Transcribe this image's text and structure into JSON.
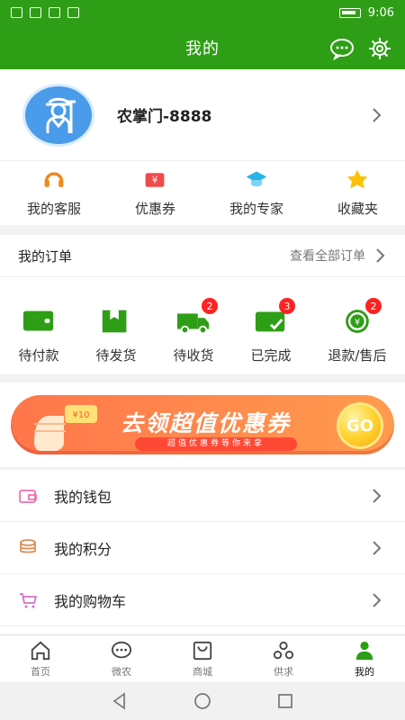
{
  "status": {
    "time": "9:06"
  },
  "header": {
    "title": "我的"
  },
  "profile": {
    "name": "农掌门-8888"
  },
  "quick_links": [
    {
      "label": "我的客服",
      "icon": "headset-icon",
      "color": "#f0891d"
    },
    {
      "label": "优惠券",
      "icon": "coupon-icon",
      "color": "#f04b4b"
    },
    {
      "label": "我的专家",
      "icon": "graduation-cap-icon",
      "color": "#28b4e8"
    },
    {
      "label": "收藏夹",
      "icon": "star-icon",
      "color": "#ffc107"
    }
  ],
  "orders": {
    "title": "我的订单",
    "view_all": "查看全部订单",
    "items": [
      {
        "label": "待付款",
        "icon": "wallet-icon",
        "badge": ""
      },
      {
        "label": "待发货",
        "icon": "box-icon",
        "badge": ""
      },
      {
        "label": "待收货",
        "icon": "truck-icon",
        "badge": "2"
      },
      {
        "label": "已完成",
        "icon": "checked-card-icon",
        "badge": "3"
      },
      {
        "label": "退款/售后",
        "icon": "refund-icon",
        "badge": "2"
      }
    ]
  },
  "promotion": {
    "title": "去领超值优惠券",
    "subtitle": "超值优惠券等你来拿",
    "button": "GO",
    "coupon_label": "¥10"
  },
  "menu": [
    {
      "label": "我的钱包",
      "icon": "wallet-outline-icon"
    },
    {
      "label": "我的积分",
      "icon": "coins-icon"
    },
    {
      "label": "我的购物车",
      "icon": "cart-icon"
    }
  ],
  "tabs": [
    {
      "label": "首页",
      "icon": "home-icon"
    },
    {
      "label": "微农",
      "icon": "chat-icon"
    },
    {
      "label": "商城",
      "icon": "shopping-bag-icon"
    },
    {
      "label": "供求",
      "icon": "supply-icon"
    },
    {
      "label": "我的",
      "icon": "person-icon"
    }
  ],
  "colors": {
    "primary": "#2e9e16",
    "badge": "#ff2222"
  }
}
